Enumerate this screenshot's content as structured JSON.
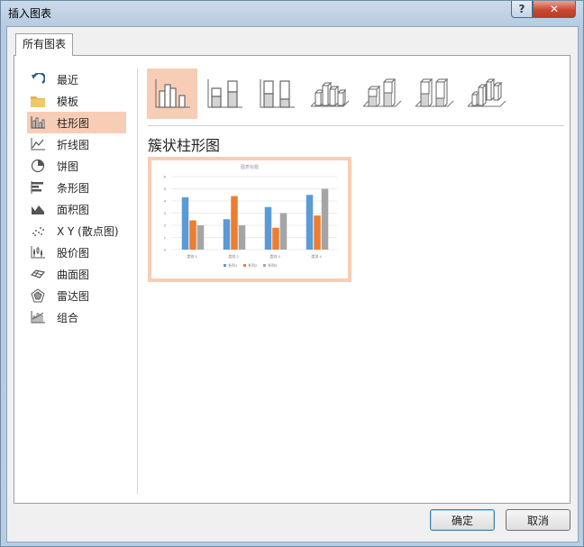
{
  "window": {
    "title": "插入图表",
    "help_label": "?",
    "close_label": "✕"
  },
  "tabs": [
    {
      "label": "所有图表",
      "selected": true
    }
  ],
  "nav": {
    "items": [
      {
        "label": "最近",
        "icon": "recent-icon"
      },
      {
        "label": "模板",
        "icon": "folder-icon"
      },
      {
        "label": "柱形图",
        "icon": "column-chart-icon",
        "selected": true
      },
      {
        "label": "折线图",
        "icon": "line-chart-icon"
      },
      {
        "label": "饼图",
        "icon": "pie-chart-icon"
      },
      {
        "label": "条形图",
        "icon": "bar-chart-icon"
      },
      {
        "label": "面积图",
        "icon": "area-chart-icon"
      },
      {
        "label": "X Y (散点图)",
        "icon": "scatter-chart-icon"
      },
      {
        "label": "股价图",
        "icon": "stock-chart-icon"
      },
      {
        "label": "曲面图",
        "icon": "surface-chart-icon"
      },
      {
        "label": "雷达图",
        "icon": "radar-chart-icon"
      },
      {
        "label": "组合",
        "icon": "combo-chart-icon"
      }
    ]
  },
  "subtypes": [
    {
      "icon": "clustered-column-icon",
      "selected": true
    },
    {
      "icon": "stacked-column-icon"
    },
    {
      "icon": "100-stacked-column-icon"
    },
    {
      "icon": "3d-clustered-column-icon"
    },
    {
      "icon": "3d-stacked-column-icon"
    },
    {
      "icon": "3d-100-stacked-column-icon"
    },
    {
      "icon": "3d-column-icon"
    }
  ],
  "main": {
    "heading": "簇状柱形图"
  },
  "chart_data": {
    "type": "bar",
    "title": "图表标题",
    "categories": [
      "类别 1",
      "类别 2",
      "类别 3",
      "类别 4"
    ],
    "series": [
      {
        "name": "系列1",
        "values": [
          4.3,
          2.5,
          3.5,
          4.5
        ],
        "color": "#5b9bd5"
      },
      {
        "name": "系列2",
        "values": [
          2.4,
          4.4,
          1.8,
          2.8
        ],
        "color": "#ed7d31"
      },
      {
        "name": "系列3",
        "values": [
          2,
          2,
          3,
          5
        ],
        "color": "#a5a5a5"
      }
    ],
    "ylim": [
      0,
      6
    ],
    "yticks": [
      "0",
      "1",
      "2",
      "3",
      "4",
      "5",
      "6"
    ],
    "grid": true,
    "legend": "bottom"
  },
  "buttons": {
    "ok": "确定",
    "cancel": "取消"
  },
  "colors": {
    "selection": "#f8cdb5",
    "accent_blue": "#5b9bd5",
    "accent_orange": "#ed7d31",
    "accent_gray": "#a5a5a5"
  }
}
